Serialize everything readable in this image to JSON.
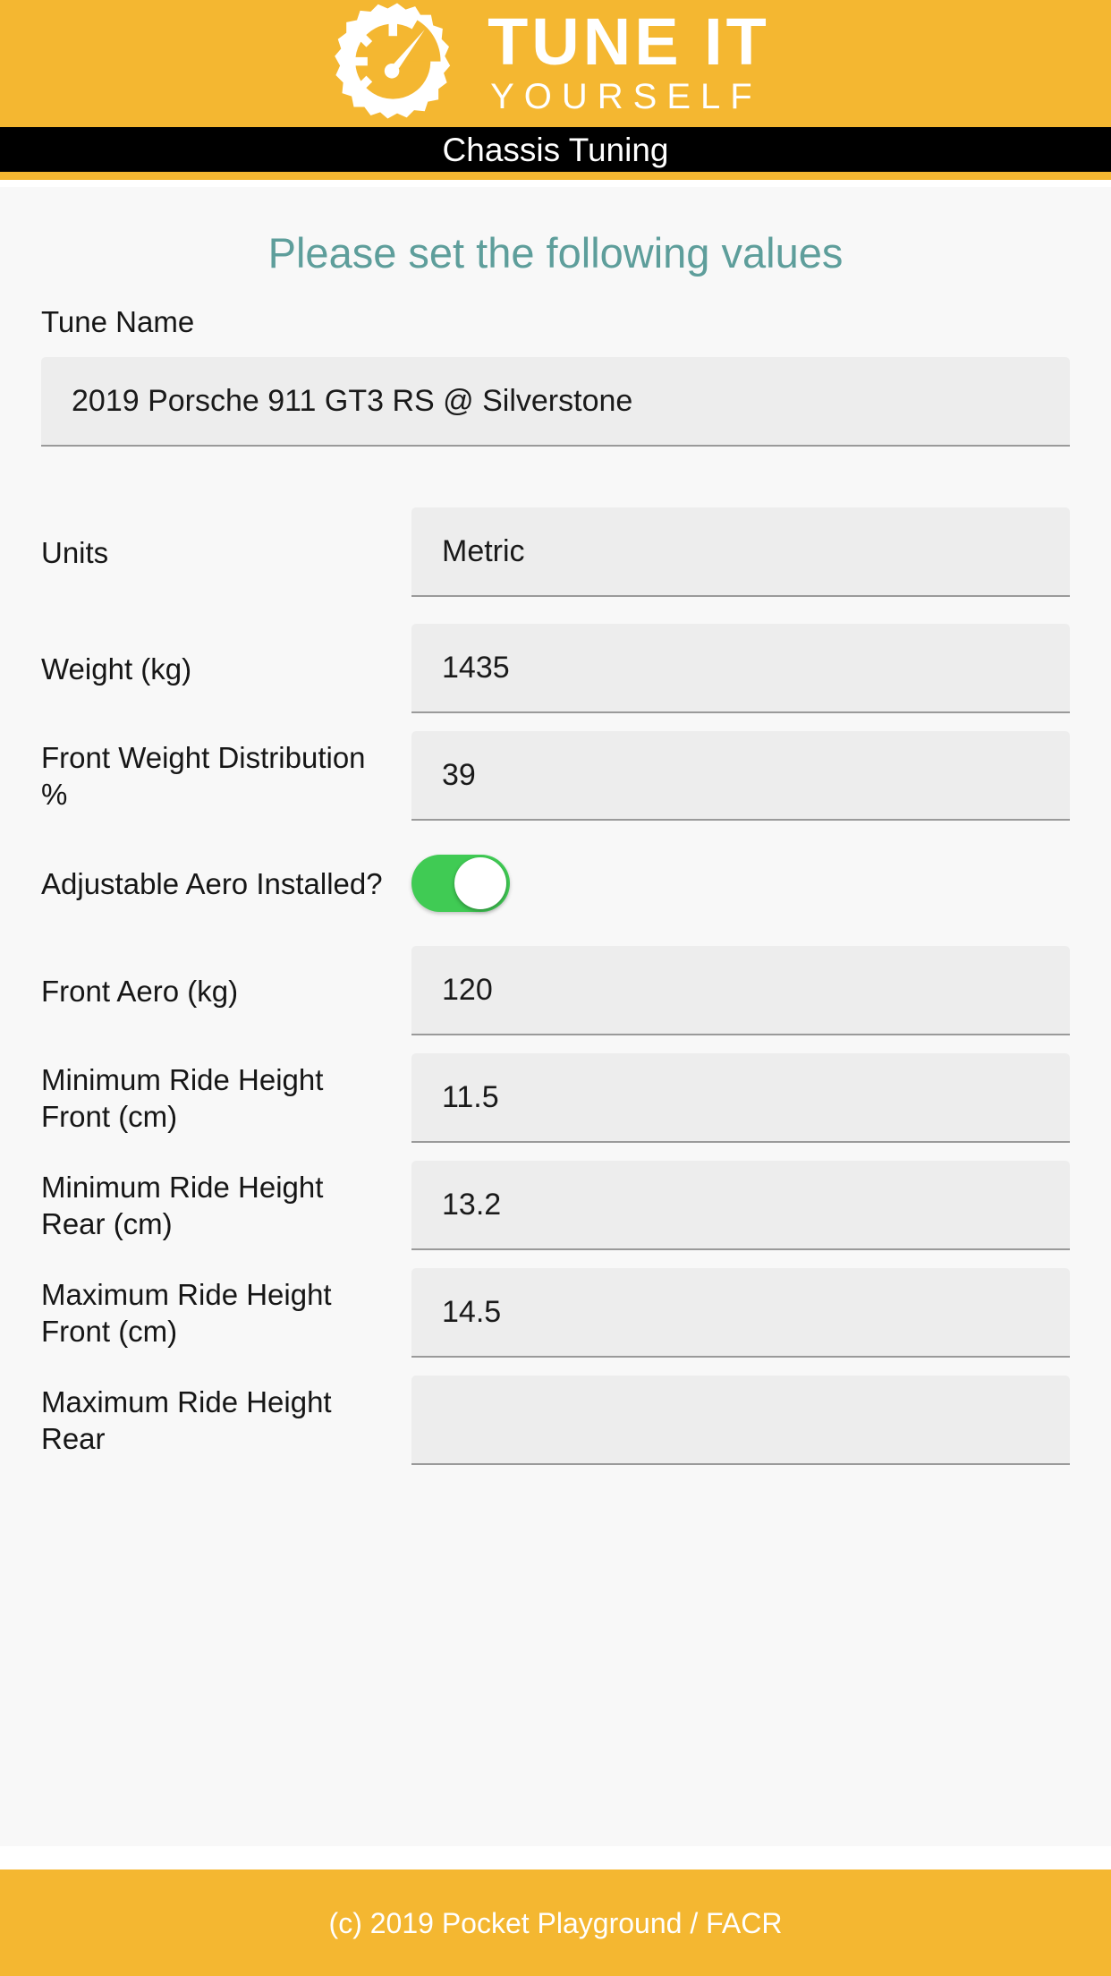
{
  "brand": {
    "logo_icon": "gear-speedometer-icon",
    "name_line1": "TUNE IT",
    "name_line2": "YOURSELF",
    "accent_color": "#F4B731"
  },
  "titlebar": {
    "title": "Chassis Tuning",
    "background_color": "#000000",
    "text_color": "#FFFFFF"
  },
  "page": {
    "heading": "Please set the following values",
    "heading_color": "#5E9E9B",
    "background_color": "#F8F8F8"
  },
  "tune_name": {
    "label": "Tune Name",
    "value": "2019 Porsche 911 GT3 RS @ Silverstone",
    "placeholder": "Tune Name"
  },
  "fields": [
    {
      "label": "Units",
      "value": "Metric",
      "type": "select",
      "name": "units"
    },
    {
      "label": "Weight (kg)",
      "value": "1435",
      "type": "number",
      "name": "weight"
    },
    {
      "label": "Front Weight Distribution %",
      "value": "39",
      "type": "number",
      "name": "front-weight-distribution"
    },
    {
      "label": "Adjustable Aero Installed?",
      "value": "on",
      "type": "toggle",
      "name": "adjustable-aero",
      "toggle_color": "#40CB54"
    },
    {
      "label": "Front Aero (kg)",
      "value": "120",
      "type": "number",
      "name": "front-aero"
    },
    {
      "label": "Minimum Ride Height Front (cm)",
      "value": "11.5",
      "type": "number",
      "name": "min-ride-height-front"
    },
    {
      "label": "Minimum Ride Height Rear (cm)",
      "value": "13.2",
      "type": "number",
      "name": "min-ride-height-rear"
    },
    {
      "label": "Maximum Ride Height Front (cm)",
      "value": "14.5",
      "type": "number",
      "name": "max-ride-height-front"
    },
    {
      "label": "Maximum Ride Height Rear",
      "value": "",
      "type": "number",
      "name": "max-ride-height-rear"
    }
  ],
  "footer": {
    "text": "(c) 2019 Pocket Playground / FACR",
    "background_color": "#F4B731",
    "text_color": "#FFFFFF"
  }
}
